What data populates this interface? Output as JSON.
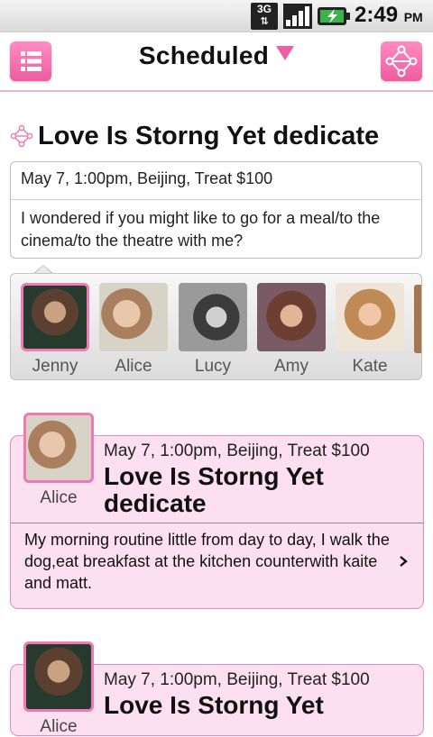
{
  "status_bar": {
    "network": "3G",
    "time": "2:49",
    "ampm": "PM"
  },
  "header": {
    "title": "Scheduled",
    "menu_icon": "list-icon",
    "share_icon": "share-nodes-icon"
  },
  "featured": {
    "title": "Love Is Storng Yet dedicate",
    "meta": "May 7, 1:00pm, Beijing, Treat $100",
    "message": "I wondered if you might like to go for a meal/to the cinema/to the theatre with me?"
  },
  "people": [
    {
      "name": "Jenny",
      "selected": true
    },
    {
      "name": "Alice",
      "selected": false
    },
    {
      "name": "Lucy",
      "selected": false
    },
    {
      "name": "Amy",
      "selected": false
    },
    {
      "name": "Kate",
      "selected": false
    }
  ],
  "events": [
    {
      "person": "Alice",
      "meta": "May 7, 1:00pm, Beijing, Treat $100",
      "title": "Love Is Storng Yet dedicate",
      "body": "My morning routine little from day to day, I walk the dog,eat breakfast at the kitchen counterwith kaite and matt."
    },
    {
      "person": "Alice",
      "meta": "May 7, 1:00pm, Beijing, Treat $100",
      "title": "Love Is Storng Yet"
    }
  ],
  "colors": {
    "accent": "#f05ea6",
    "card_bg": "#fde0ef",
    "card_border": "#ef86bd"
  }
}
